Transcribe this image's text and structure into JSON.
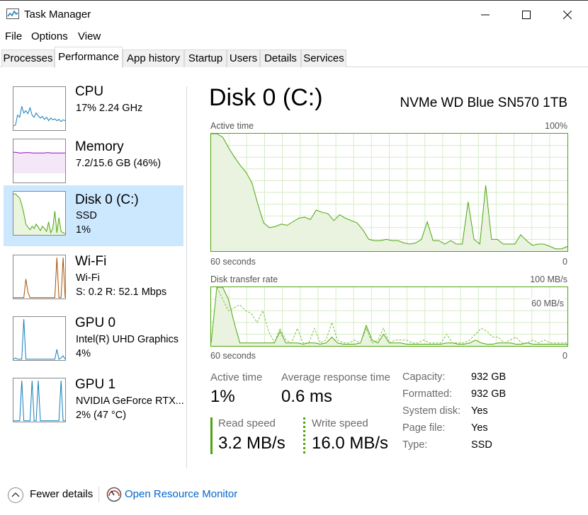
{
  "window": {
    "title": "Task Manager",
    "icon": "task-manager-icon",
    "controls": [
      "minimize-icon",
      "maximize-icon",
      "close-icon"
    ]
  },
  "menu": [
    "File",
    "Options",
    "View"
  ],
  "tabs": [
    "Processes",
    "Performance",
    "App history",
    "Startup",
    "Users",
    "Details",
    "Services"
  ],
  "active_tab": "Performance",
  "sidebar": [
    {
      "title": "CPU",
      "line1": "17%  2.24 GHz",
      "line2": "",
      "color": "#117dbb",
      "series": [
        0.1,
        0.12,
        0.35,
        0.3,
        0.55,
        0.4,
        0.45,
        0.38,
        0.52,
        0.35,
        0.3,
        0.4,
        0.33,
        0.28,
        0.32,
        0.25,
        0.3,
        0.22,
        0.28,
        0.24,
        0.26,
        0.22,
        0.25,
        0.2,
        0.24,
        0.22
      ]
    },
    {
      "title": "Memory",
      "line1": "7.2/15.6 GB (46%)",
      "line2": "",
      "color": "#8b12ae",
      "series": [
        0.62,
        0.62,
        0.61,
        0.6,
        0.6,
        0.61,
        0.61,
        0.61,
        0.61,
        0.6,
        0.6,
        0.6,
        0.6,
        0.6,
        0.6,
        0.6,
        0.61,
        0.61,
        0.6,
        0.6,
        0.6,
        0.6,
        0.6,
        0.6,
        0.6,
        0.6
      ]
    },
    {
      "title": "Disk 0 (C:)",
      "line1": "SSD",
      "line2": "1%",
      "color": "#4da60c",
      "series": [
        0.95,
        0.95,
        0.9,
        0.85,
        0.7,
        0.5,
        0.25,
        0.18,
        0.12,
        0.2,
        0.15,
        0.25,
        0.18,
        0.1,
        0.2,
        0.15,
        0.08,
        0.3,
        0.05,
        0.15,
        0.55,
        0.05,
        0.4,
        0.08,
        0.05,
        0.03
      ]
    },
    {
      "title": "Wi-Fi",
      "line1": "Wi-Fi",
      "line2": "S: 0.2  R: 52.1 Mbps",
      "color": "#a74f01",
      "series": [
        0.02,
        0.02,
        0.02,
        0.02,
        0.02,
        0.02,
        0.45,
        0.15,
        0.02,
        0.02,
        0.02,
        0.02,
        0.02,
        0.02,
        0.02,
        0.02,
        0.02,
        0.02,
        0.02,
        0.02,
        0.02,
        0.95,
        0.02,
        0.02,
        0.95,
        0.02
      ]
    },
    {
      "title": "GPU 0",
      "line1": "Intel(R) UHD Graphics",
      "line2": "4%",
      "color": "#117dbb",
      "series": [
        0.02,
        0.05,
        0.02,
        0.02,
        0.02,
        0.95,
        0.02,
        0.02,
        0.02,
        0.02,
        0.02,
        0.02,
        0.02,
        0.02,
        0.02,
        0.02,
        0.02,
        0.02,
        0.02,
        0.02,
        0.02,
        0.25,
        0.02,
        0.05,
        0.1,
        0.02
      ]
    },
    {
      "title": "GPU 1",
      "line1": "NVIDIA GeForce RTX...",
      "line2": "2% (47 °C)",
      "color": "#117dbb",
      "series": [
        0.02,
        0.02,
        0.02,
        0.02,
        0.95,
        0.02,
        0.02,
        0.02,
        0.02,
        0.95,
        0.02,
        0.02,
        0.95,
        0.02,
        0.02,
        0.02,
        0.02,
        0.02,
        0.02,
        0.02,
        0.02,
        0.02,
        0.02,
        0.95,
        0.02,
        0.02
      ]
    }
  ],
  "selected_item": "Disk 0 (C:)",
  "main": {
    "title": "Disk 0 (C:)",
    "model": "NVMe WD Blue SN570 1TB",
    "graph1": {
      "label": "Active time",
      "max": "100%",
      "xlabel": "60 seconds",
      "min": "0",
      "values": [
        100,
        100,
        97,
        88,
        80,
        73,
        67,
        58,
        40,
        24,
        20,
        21,
        23,
        22,
        25,
        28,
        29,
        27,
        35,
        33,
        32,
        26,
        31,
        28,
        26,
        24,
        18,
        10,
        9,
        9,
        10,
        9,
        9,
        7,
        6,
        7,
        10,
        25,
        9,
        9,
        6,
        9,
        6,
        6,
        42,
        10,
        6,
        56,
        10,
        10,
        6,
        6,
        6,
        14,
        9,
        5,
        6,
        6,
        4,
        2,
        2,
        4
      ]
    },
    "graph2": {
      "label": "Disk transfer rate",
      "max": "100 MB/s",
      "mid": "60 MB/s",
      "xlabel": "60 seconds",
      "min": "0",
      "read": [
        5,
        100,
        100,
        80,
        40,
        5,
        5,
        5,
        5,
        5,
        5,
        5,
        25,
        5,
        5,
        5,
        3,
        5,
        5,
        3,
        5,
        15,
        5,
        3,
        3,
        3,
        5,
        35,
        10,
        5,
        20,
        5,
        5,
        5,
        3,
        3,
        3,
        3,
        3,
        3,
        3,
        5,
        5,
        3,
        3,
        5,
        10,
        5,
        3,
        3,
        5,
        5,
        5,
        3,
        3,
        5,
        3,
        3,
        3,
        3,
        3,
        3,
        3
      ],
      "write": [
        5,
        100,
        80,
        60,
        65,
        70,
        60,
        55,
        40,
        60,
        25,
        5,
        30,
        10,
        5,
        30,
        5,
        5,
        30,
        5,
        10,
        40,
        10,
        5,
        5,
        10,
        5,
        30,
        5,
        10,
        30,
        5,
        10,
        10,
        10,
        5,
        5,
        10,
        5,
        5,
        5,
        20,
        5,
        5,
        5,
        10,
        20,
        30,
        25,
        15,
        15,
        5,
        10,
        15,
        5,
        5,
        10,
        5,
        10,
        5,
        5,
        5,
        5
      ]
    }
  },
  "stats": {
    "active_time": {
      "label": "Active time",
      "value": "1%"
    },
    "avg_response": {
      "label": "Average response time",
      "value": "0.6 ms"
    },
    "read_speed": {
      "label": "Read speed",
      "value": "3.2 MB/s"
    },
    "write_speed": {
      "label": "Write speed",
      "value": "16.0 MB/s"
    }
  },
  "properties": [
    {
      "label": "Capacity:",
      "value": "932 GB"
    },
    {
      "label": "Formatted:",
      "value": "932 GB"
    },
    {
      "label": "System disk:",
      "value": "Yes"
    },
    {
      "label": "Page file:",
      "value": "Yes"
    },
    {
      "label": "Type:",
      "value": "SSD"
    }
  ],
  "footer": {
    "fewer_details": "Fewer details",
    "resource_monitor": "Open Resource Monitor",
    "fewer_icon": "chevron-up-icon",
    "monitor_icon": "resource-monitor-icon"
  },
  "colors": {
    "disk": "#4da60c",
    "disk_fill": "#e9f3e0",
    "grid": "#d6ecc6",
    "selected": "#cce8ff",
    "link": "#0066cc"
  }
}
